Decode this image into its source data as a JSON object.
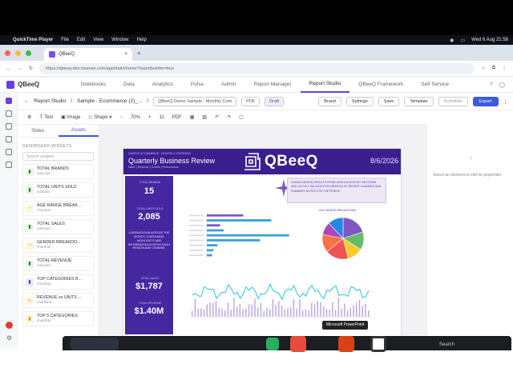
{
  "mac": {
    "app": "QuickTime Player",
    "menus": [
      "File",
      "Edit",
      "View",
      "Window",
      "Help"
    ],
    "clock": "Wed 6 Aug 21:58"
  },
  "browser": {
    "tab_title": "QBeeQ",
    "url": "https://qbeeq-dev.sisense.com/app/main/home?reportbuilder=true"
  },
  "app": {
    "logo": "QBeeQ",
    "nav": [
      "Notebooks",
      "Data",
      "Analytics",
      "Pulse",
      "Admin",
      "Report Manager",
      "Report Studio",
      "QBeeQ Framework",
      "Self Service"
    ],
    "active_nav": "Report Studio"
  },
  "crumbs": {
    "root": "Report Studio",
    "mid": "Sample - Ecommerce (2)_...",
    "current": "QBeeQ Demo Sample - Monthly Com",
    "format": "PDF",
    "draft": "Draft",
    "brand": "Brand",
    "settings": "Settings",
    "save": "Save",
    "template": "Template",
    "schedule": "Schedule",
    "export": "Export"
  },
  "toolbar": {
    "text": "Text",
    "image": "Image",
    "shape": "Shape",
    "zoom": "70%",
    "font_size": "11",
    "paper": "PDF"
  },
  "panel": {
    "tabs": [
      "Slides",
      "Assets"
    ],
    "active_tab": "Assets",
    "section_label": "DASHBOARD WIDGETS",
    "search_placeholder": "Search widgets",
    "widgets": [
      {
        "name": "TOTAL BRANDS",
        "type": "indicator",
        "icon": "indicator-icon",
        "tone": "green"
      },
      {
        "name": "TOTAL UNITS SOLD",
        "type": "indicator",
        "icon": "indicator-icon",
        "tone": "green"
      },
      {
        "name": "AGE RANGE BREAK...",
        "type": "chart/pie",
        "icon": "pie-chart-icon",
        "tone": "yellow"
      },
      {
        "name": "TOTAL SALES",
        "type": "indicator",
        "icon": "indicator-icon",
        "tone": "green"
      },
      {
        "name": "GENDER BREAKDO...",
        "type": "chart/pie",
        "icon": "pie-chart-icon",
        "tone": "yellow"
      },
      {
        "name": "TOTAL REVENUE",
        "type": "indicator",
        "icon": "indicator-icon",
        "tone": "green"
      },
      {
        "name": "TOP CATEGORIES B...",
        "type": "chart/bar",
        "icon": "bar-chart-icon",
        "tone": "purple"
      },
      {
        "name": "REVENUE vs UNITS ...",
        "type": "chart/line",
        "icon": "line-chart-icon",
        "tone": "yellow"
      },
      {
        "name": "TOP 5 CATEGORIES",
        "type": "chart/bar",
        "icon": "bar-chart-icon",
        "tone": "yellow"
      }
    ]
  },
  "report": {
    "kicker": "SAMPLE ECOMMERCE - MONTHLY OVERVIEW",
    "title": "Quarterly Business Review",
    "subtitle": "Sales | Revenue | Growth | Performance",
    "logo_text": "QBeeQ",
    "date": "8/6/2026",
    "kpis": [
      {
        "label": "TOTAL BRANDS",
        "value": "15"
      },
      {
        "label": "TOTAL UNITS SOLD",
        "value": "2,085"
      },
      {
        "label": "TOTAL SALES",
        "value": "$1,787"
      },
      {
        "label": "TOTAL REVENUE",
        "value": "$1.40M"
      }
    ],
    "kpi_desc": "A BREAKDOWN ACROSS THE MONTH, CONTAINING HIGHLIGHTS AND INFORMATION ACROSS EACH REGION AND CHANNEL",
    "info_text": "CONSOLIDATED RESULTS FROM VARIOUS REPORT SECTIONS AND LAYOUT. INCLUDE EXPLORATION OF RECENT CHANGES AND SUMMARY NOTES FOR THE PERIOD.",
    "pie_title": "AGE RANGE BREAKDOWN"
  },
  "right_panel": {
    "message": "Select an element to edit its properties"
  },
  "tooltip": "Microsoft PowerPoint",
  "dock": {
    "search": "Search"
  },
  "colors": {
    "accent": "#3b5bdb",
    "brand": "#3a1f8f",
    "kpi_column": "#4527a0",
    "bar": "#3aa0d6",
    "bar_alt": "#7e57c2"
  },
  "chart_data": [
    {
      "type": "bar",
      "orientation": "horizontal",
      "values": [
        820,
        1450,
        300,
        380,
        1850,
        1200,
        240,
        150,
        120
      ],
      "xlim": [
        0,
        2200
      ],
      "colors": [
        "#7e57c2",
        "#3aa0d6",
        "#7e57c2",
        "#3aa0d6",
        "#3aa0d6",
        "#3aa0d6",
        "#3aa0d6",
        "#3aa0d6",
        "#3aa0d6"
      ]
    },
    {
      "type": "pie",
      "title": "AGE RANGE BREAKDOWN",
      "values": [
        20,
        14,
        12,
        18,
        14,
        10,
        12
      ],
      "colors": [
        "#7e57c2",
        "#66bb6a",
        "#ffca28",
        "#ef5350",
        "#ff7043",
        "#ab47bc",
        "#1e88e5"
      ]
    },
    {
      "type": "line",
      "points": 60,
      "series_color": "#26c6da",
      "bar_color": "#7e57c2"
    }
  ]
}
